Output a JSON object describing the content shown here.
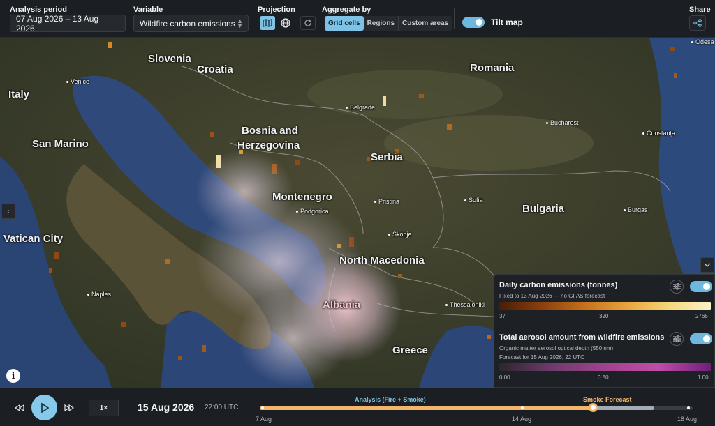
{
  "toolbar": {
    "analysis_period_label": "Analysis period",
    "analysis_period_value": "07 Aug 2026 – 13 Aug 2026",
    "variable_label": "Variable",
    "variable_value": "Wildfire carbon emissions",
    "projection_label": "Projection",
    "aggregate_label": "Aggregate by",
    "aggregate_options": [
      "Grid cells",
      "Regions",
      "Custom areas"
    ],
    "aggregate_selected": "Grid cells",
    "tilt_label": "Tilt map",
    "tilt_enabled": true,
    "share_label": "Share",
    "accent": "#7ec3e6"
  },
  "map": {
    "countries": {
      "slovenia": "Slovenia",
      "croatia": "Croatia",
      "italy": "Italy",
      "san_marino": "San Marino",
      "bosnia_line1": "Bosnia and",
      "bosnia_line2": "Herzegovina",
      "serbia": "Serbia",
      "romania": "Romania",
      "montenegro": "Montenegro",
      "bulgaria": "Bulgaria",
      "vatican": "Vatican City",
      "north_macedonia": "North Macedonia",
      "albania": "Albania",
      "greece": "Greece"
    },
    "cities": {
      "venice": "Venice",
      "belgrade": "Belgrade",
      "bucharest": "Bucharest",
      "constanta": "Constanța",
      "odesa": "Odesa",
      "podgorica": "Podgorica",
      "pristina": "Pristina",
      "sofia": "Sofia",
      "burgas": "Burgas",
      "skopje": "Skopje",
      "naples": "Naples",
      "thessaloniki": "Thessaloniki"
    }
  },
  "legend": {
    "carbon": {
      "title": "Daily carbon emissions (tonnes)",
      "subtitle": "Fixed to 13 Aug 2026 — no GFAS forecast",
      "min": "37",
      "mid": "320",
      "max": "2765",
      "enabled": true
    },
    "aerosol": {
      "title": "Total aerosol amount from wildfire emissions",
      "subtitle1": "Organic matter aerosol optical depth (550 nm)",
      "subtitle2": "Forecast for 15 Aug 2026, 22 UTC",
      "min": "0.00",
      "mid": "0.50",
      "max": "1.00",
      "enabled": true
    }
  },
  "timeline": {
    "speed": "1×",
    "current_date": "15 Aug 2026",
    "current_time": "22:00 UTC",
    "analysis_phase_label": "Analysis (Fire + Smoke)",
    "forecast_phase_label": "Smoke Forecast",
    "start_label": "7 Aug",
    "mid_label": "14 Aug",
    "end_label": "18 Aug",
    "analysis_color": "#7ec3e6",
    "forecast_color": "#f3b56b"
  }
}
